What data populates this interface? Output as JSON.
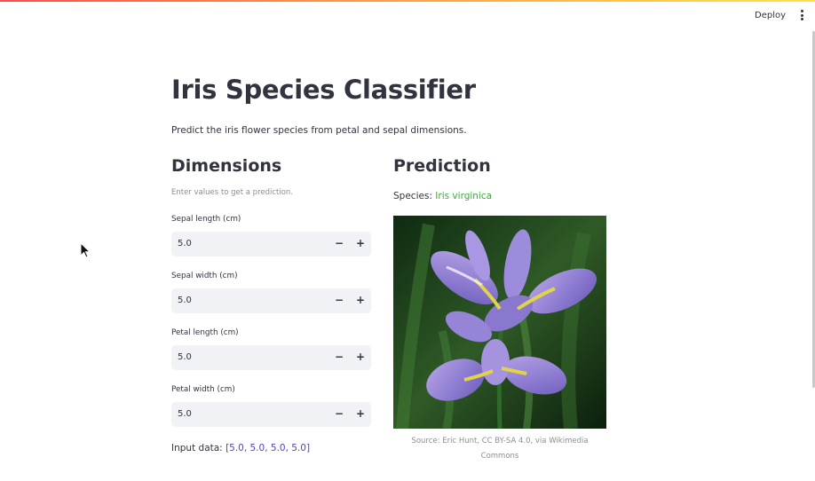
{
  "header": {
    "deploy_label": "Deploy",
    "menu_icon": "more-vertical-icon"
  },
  "page": {
    "title": "Iris Species Classifier",
    "subtitle": "Predict the iris flower species from petal and sepal dimensions."
  },
  "dimensions": {
    "heading": "Dimensions",
    "caption": "Enter values to get a prediction.",
    "fields": [
      {
        "label": "Sepal length (cm)",
        "value": "5.0"
      },
      {
        "label": "Sepal width (cm)",
        "value": "5.0"
      },
      {
        "label": "Petal length (cm)",
        "value": "5.0"
      },
      {
        "label": "Petal width (cm)",
        "value": "5.0"
      }
    ],
    "stepper_minus": "−",
    "stepper_plus": "+",
    "input_data_label": "Input data: ",
    "input_data_values": "[5.0, 5.0, 5.0, 5.0]"
  },
  "prediction": {
    "heading": "Prediction",
    "species_label": "Species: ",
    "species_value": "Iris virginica",
    "image_alt": "iris flower photo",
    "image_caption": "Source: Eric Hunt, CC BY-SA 4.0, via Wikimedia Commons"
  },
  "colors": {
    "accent_red": "#ff4b4b",
    "species_green": "#3dab3d",
    "input_data_blue": "#4b44c8",
    "input_bg": "#f0f2f6"
  }
}
